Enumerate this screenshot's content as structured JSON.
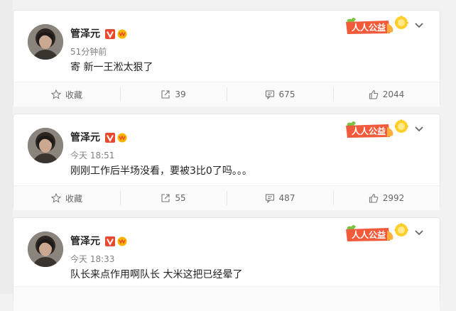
{
  "colors": {
    "accent": "#ff8200",
    "verified": "#ff8200",
    "gongyi_red": "#e8482d"
  },
  "posts": [
    {
      "author": "管泽元",
      "time": "51分钟前",
      "text": "寄 新一王淞太狠了",
      "badge_text": "人人公益",
      "actions": {
        "favorite_label": "收藏",
        "repost": "39",
        "comment": "675",
        "like": "2044"
      }
    },
    {
      "author": "管泽元",
      "time": "今天 18:51",
      "text": "刚刚工作后半场没看，要被3比0了吗。。。",
      "badge_text": "人人公益",
      "actions": {
        "favorite_label": "收藏",
        "repost": "55",
        "comment": "487",
        "like": "2992"
      }
    },
    {
      "author": "管泽元",
      "time": "今天 18:33",
      "text": "队长来点作用啊队长 大米这把已经晕了",
      "badge_text": "人人公益"
    }
  ],
  "icons": [
    "verified-v-icon",
    "vip-icon",
    "gongyi-badge-icon",
    "chevron-down-icon",
    "star-icon",
    "repost-icon",
    "comment-icon",
    "like-icon"
  ]
}
